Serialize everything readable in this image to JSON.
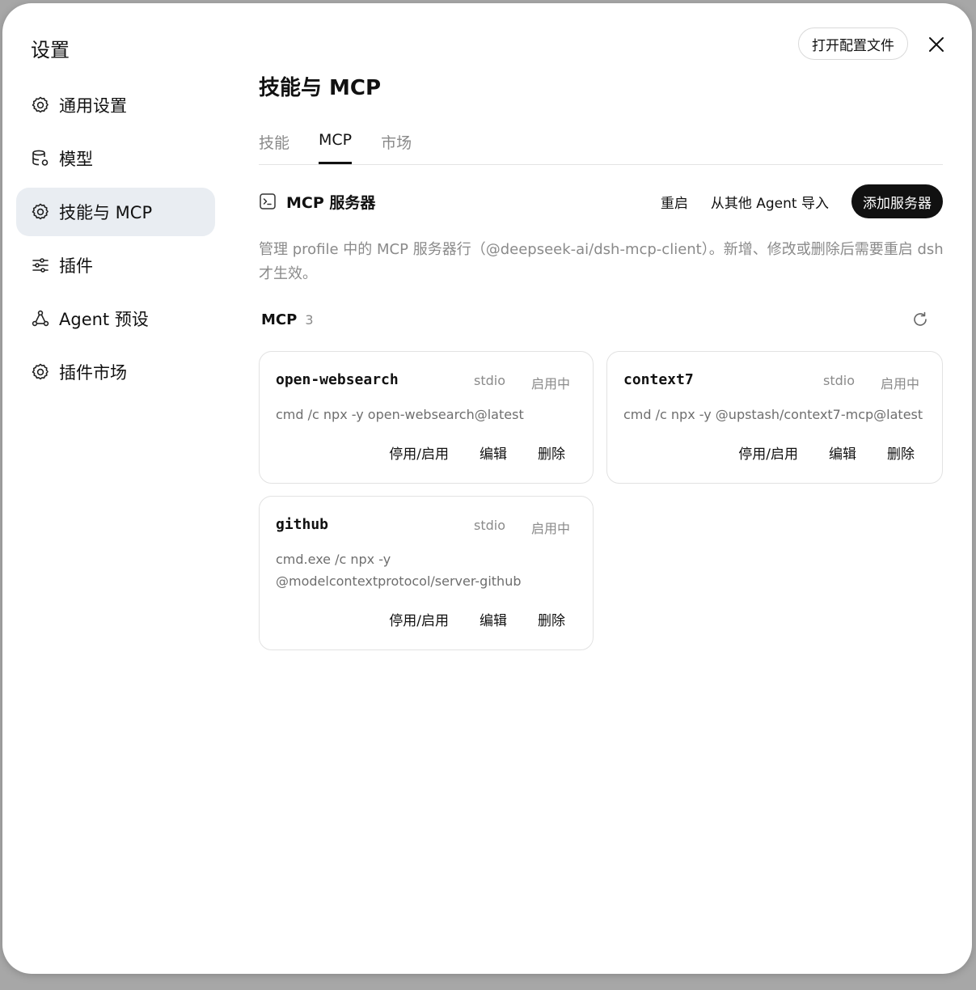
{
  "sidebar": {
    "title": "设置",
    "items": [
      {
        "label": "通用设置",
        "icon": "gear-icon"
      },
      {
        "label": "模型",
        "icon": "database-icon"
      },
      {
        "label": "技能与 MCP",
        "icon": "gear-icon",
        "active": true
      },
      {
        "label": "插件",
        "icon": "sliders-icon"
      },
      {
        "label": "Agent 预设",
        "icon": "nodes-icon"
      },
      {
        "label": "插件市场",
        "icon": "gear-icon"
      }
    ]
  },
  "header": {
    "open_config": "打开配置文件",
    "close_icon": "close-icon"
  },
  "main": {
    "title": "技能与 MCP",
    "tabs": [
      {
        "label": "技能",
        "active": false
      },
      {
        "label": "MCP",
        "active": true
      },
      {
        "label": "市场",
        "active": false
      }
    ],
    "section": {
      "title": "MCP 服务器",
      "icon": "terminal-icon",
      "restart": "重启",
      "import": "从其他 Agent 导入",
      "add": "添加服务器"
    },
    "description": "管理 profile 中的 MCP 服务器行（@deepseek-ai/dsh-mcp-client）。新增、修改或删除后需要重启 dsh 才生效。",
    "list": {
      "label": "MCP",
      "count": "3",
      "refresh_icon": "refresh-icon"
    },
    "servers": [
      {
        "name": "open-websearch",
        "type": "stdio",
        "status": "启用中",
        "cmd": "cmd /c npx -y open-websearch@latest"
      },
      {
        "name": "context7",
        "type": "stdio",
        "status": "启用中",
        "cmd": "cmd /c npx -y @upstash/context7-mcp@latest"
      },
      {
        "name": "github",
        "type": "stdio",
        "status": "启用中",
        "cmd": "cmd.exe /c npx -y @modelcontextprotocol/server-github"
      }
    ],
    "card_actions": {
      "toggle": "停用/启用",
      "edit": "编辑",
      "delete": "删除"
    }
  },
  "colors": {
    "active_nav_bg": "#e9edf2",
    "primary_button_bg": "#111111",
    "muted_text": "#8a8a8a"
  }
}
